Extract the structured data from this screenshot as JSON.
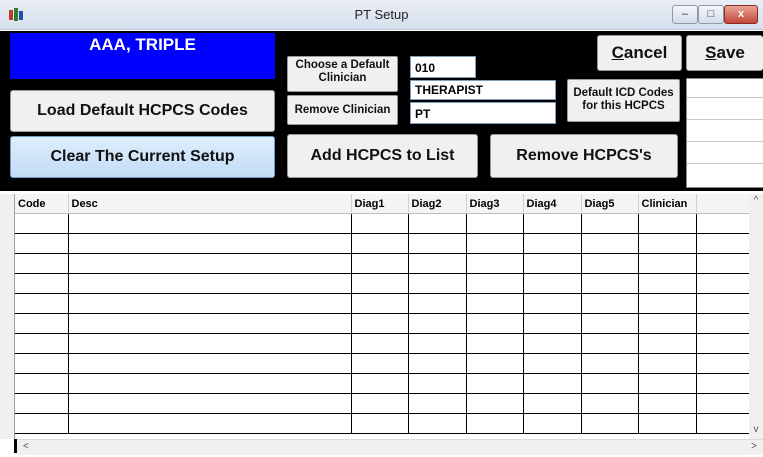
{
  "window": {
    "title": "PT Setup",
    "minimize": "–",
    "maximize": "□",
    "close": "x"
  },
  "patient": {
    "name": "AAA, TRIPLE"
  },
  "buttons": {
    "load_defaults": "Load Default HCPCS Codes",
    "clear_setup": "Clear The Current Setup",
    "choose_clinician": "Choose a Default Clinician",
    "remove_clinician": "Remove Clinician",
    "add_hcpcs": "Add HCPCS to List",
    "remove_hcpcs": "Remove  HCPCS's",
    "icd_codes": "Default ICD Codes for this HCPCS",
    "cancel": "Cancel",
    "save": "Save"
  },
  "clinician": {
    "code": "010",
    "name": "THERAPIST",
    "type": "PT"
  },
  "grid": {
    "columns": [
      "Code",
      "Desc",
      "Diag1",
      "Diag2",
      "Diag3",
      "Diag4",
      "Diag5",
      "Clinician",
      ""
    ],
    "empty_row_count": 11
  },
  "scrollbars": {
    "up": "^",
    "down": "v",
    "left": "<",
    "right": ">"
  },
  "colors": {
    "header_bg": "#000000",
    "patient_bg": "#0000ff",
    "patient_text": "#ffffff"
  }
}
